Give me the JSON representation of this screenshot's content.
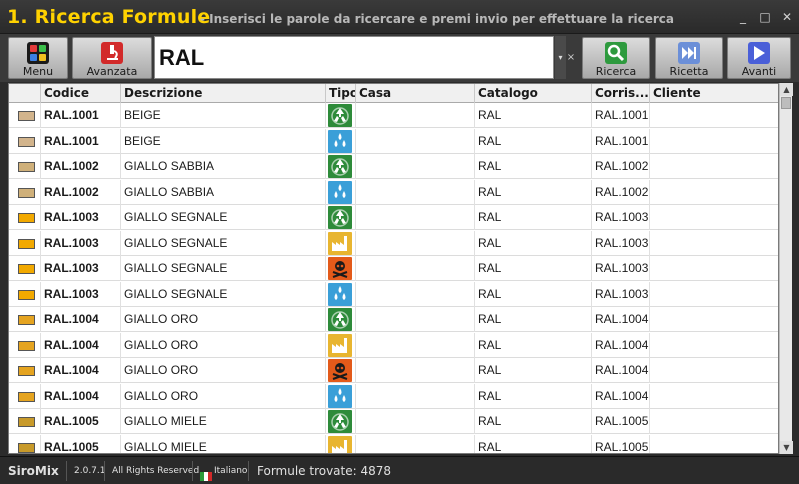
{
  "window": {
    "title": "1. Ricerca Formule",
    "subtitle": "- Inserisci le parole da ricercare e premi invio per effettuare la ricerca",
    "controls": {
      "minimize": "_",
      "maximize": "□",
      "close": "✕"
    }
  },
  "toolbar": {
    "menu_label": "Menu",
    "advanced_label": "Avanzata",
    "search_value": "RAL",
    "search_label": "Ricerca",
    "recipe_label": "Ricetta",
    "next_label": "Avanti",
    "dropdown_arrow": "▾",
    "clear": "×"
  },
  "grid": {
    "columns": [
      "Codice",
      "Descrizione",
      "Tipo",
      "Casa",
      "Catalogo",
      "Corris...",
      "Cliente"
    ],
    "rows": [
      {
        "code": "RAL.1001",
        "desc": "BEIGE",
        "type": "recycle",
        "casa": "",
        "catalogo": "RAL",
        "corr": "RAL.1001",
        "cliente": "",
        "swatch": "#d2b48c"
      },
      {
        "code": "RAL.1001",
        "desc": "BEIGE",
        "type": "drop",
        "casa": "",
        "catalogo": "RAL",
        "corr": "RAL.1001",
        "cliente": "",
        "swatch": "#d2b48c"
      },
      {
        "code": "RAL.1002",
        "desc": "GIALLO SABBIA",
        "type": "recycle",
        "casa": "",
        "catalogo": "RAL",
        "corr": "RAL.1002",
        "cliente": "",
        "swatch": "#cfb07a"
      },
      {
        "code": "RAL.1002",
        "desc": "GIALLO SABBIA",
        "type": "drop",
        "casa": "",
        "catalogo": "RAL",
        "corr": "RAL.1002",
        "cliente": "",
        "swatch": "#cfb07a"
      },
      {
        "code": "RAL.1003",
        "desc": "GIALLO SEGNALE",
        "type": "recycle",
        "casa": "",
        "catalogo": "RAL",
        "corr": "RAL.1003",
        "cliente": "",
        "swatch": "#f2a900"
      },
      {
        "code": "RAL.1003",
        "desc": "GIALLO SEGNALE",
        "type": "factory",
        "casa": "",
        "catalogo": "RAL",
        "corr": "RAL.1003",
        "cliente": "",
        "swatch": "#f2a900"
      },
      {
        "code": "RAL.1003",
        "desc": "GIALLO SEGNALE",
        "type": "toxic",
        "casa": "",
        "catalogo": "RAL",
        "corr": "RAL.1003",
        "cliente": "",
        "swatch": "#f2a900"
      },
      {
        "code": "RAL.1003",
        "desc": "GIALLO SEGNALE",
        "type": "drop",
        "casa": "",
        "catalogo": "RAL",
        "corr": "RAL.1003",
        "cliente": "",
        "swatch": "#f2a900"
      },
      {
        "code": "RAL.1004",
        "desc": "GIALLO ORO",
        "type": "recycle",
        "casa": "",
        "catalogo": "RAL",
        "corr": "RAL.1004",
        "cliente": "",
        "swatch": "#e5a420"
      },
      {
        "code": "RAL.1004",
        "desc": "GIALLO ORO",
        "type": "factory",
        "casa": "",
        "catalogo": "RAL",
        "corr": "RAL.1004",
        "cliente": "",
        "swatch": "#e5a420"
      },
      {
        "code": "RAL.1004",
        "desc": "GIALLO ORO",
        "type": "toxic",
        "casa": "",
        "catalogo": "RAL",
        "corr": "RAL.1004",
        "cliente": "",
        "swatch": "#e5a420"
      },
      {
        "code": "RAL.1004",
        "desc": "GIALLO ORO",
        "type": "drop",
        "casa": "",
        "catalogo": "RAL",
        "corr": "RAL.1004",
        "cliente": "",
        "swatch": "#e5a420"
      },
      {
        "code": "RAL.1005",
        "desc": "GIALLO MIELE",
        "type": "recycle",
        "casa": "",
        "catalogo": "RAL",
        "corr": "RAL.1005",
        "cliente": "",
        "swatch": "#c89a2a"
      },
      {
        "code": "RAL.1005",
        "desc": "GIALLO MIELE",
        "type": "factory",
        "casa": "",
        "catalogo": "RAL",
        "corr": "RAL.1005",
        "cliente": "",
        "swatch": "#c89a2a"
      }
    ]
  },
  "status": {
    "app_name": "SiroMix",
    "version": "2.0.7.1",
    "rights": "All Rights Reserved",
    "language": "Italiano",
    "found": "Formule trovate: 4878"
  },
  "colors": {
    "title": "#ffd200",
    "recycle": "#2e8b3a",
    "drop": "#3a9fd8",
    "factory": "#e8b530",
    "toxic": "#e35a1a"
  }
}
